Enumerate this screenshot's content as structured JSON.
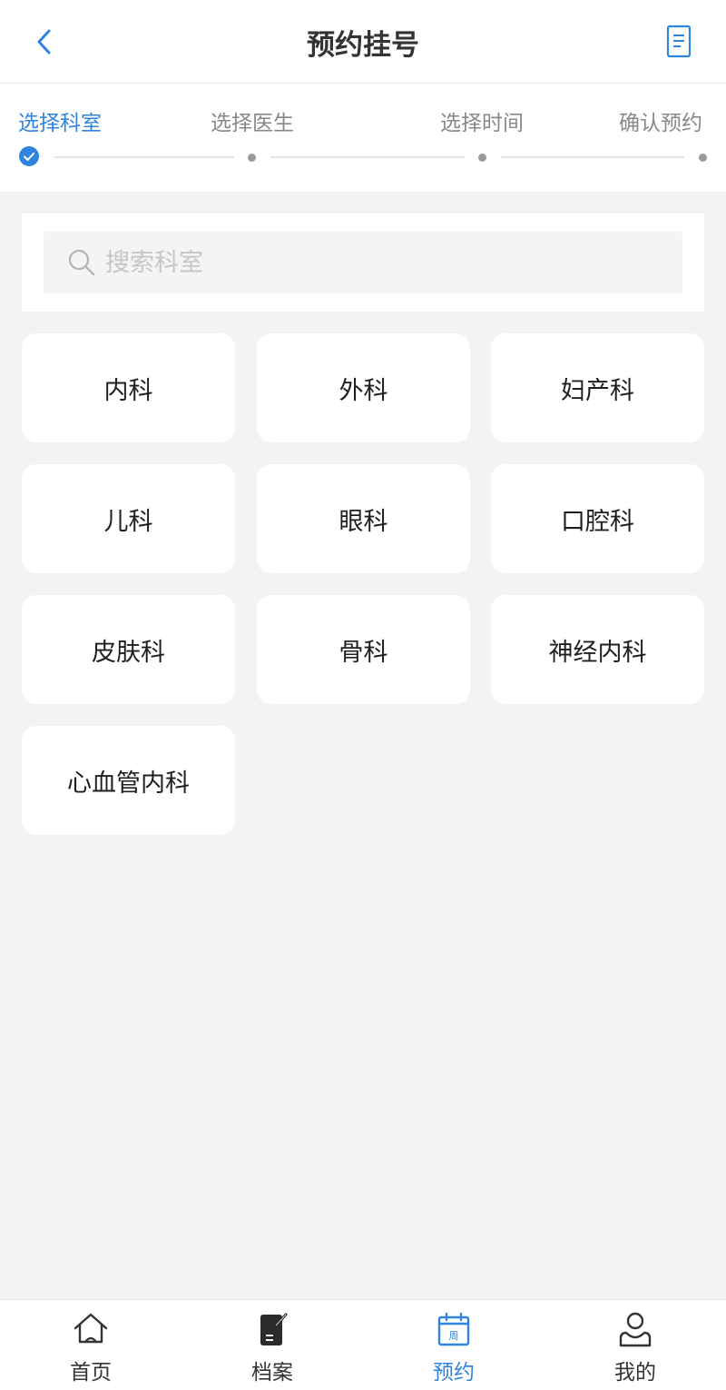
{
  "header": {
    "title": "预约挂号"
  },
  "steps": [
    {
      "label": "选择科室",
      "status": "done"
    },
    {
      "label": "选择医生",
      "status": "pending"
    },
    {
      "label": "选择时间",
      "status": "pending"
    },
    {
      "label": "确认预约",
      "status": "pending"
    }
  ],
  "search": {
    "placeholder": "搜索科室",
    "value": ""
  },
  "departments": [
    "内科",
    "外科",
    "妇产科",
    "儿科",
    "眼科",
    "口腔科",
    "皮肤科",
    "骨科",
    "神经内科",
    "心血管内科"
  ],
  "tabbar": {
    "items": [
      {
        "label": "首页",
        "icon": "home-icon"
      },
      {
        "label": "档案",
        "icon": "file-edit-icon"
      },
      {
        "label": "预约",
        "icon": "calendar-icon",
        "icon_text": "周"
      },
      {
        "label": "我的",
        "icon": "user-icon"
      }
    ],
    "active_index": 2
  },
  "colors": {
    "accent": "#2f84e0",
    "text": "#333333",
    "muted": "#888888",
    "background": "#f3f3f4"
  }
}
